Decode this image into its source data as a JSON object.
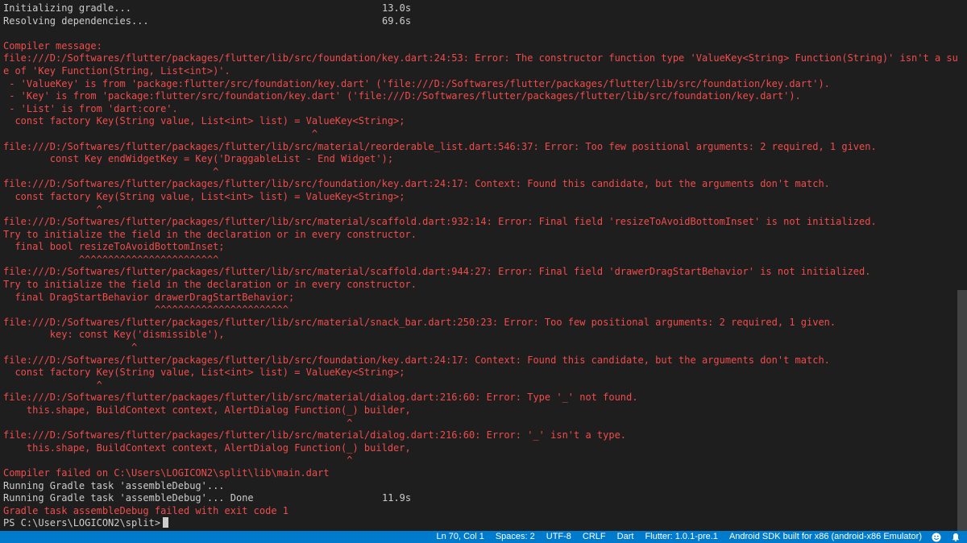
{
  "terminal": {
    "lines": [
      {
        "text": "Initializing gradle...",
        "type": "ok",
        "timing": "13.0s"
      },
      {
        "text": "Resolving dependencies...",
        "type": "ok",
        "timing": "69.6s"
      },
      {
        "text": "",
        "type": "ok"
      },
      {
        "text": "Compiler message:",
        "type": "err"
      },
      {
        "text": "file:///D:/Softwares/flutter/packages/flutter/lib/src/foundation/key.dart:24:53: Error: The constructor function type 'ValueKey<String> Function(String)' isn't a subtyp",
        "type": "err"
      },
      {
        "text": "e of 'Key Function(String, List<int>)'.",
        "type": "err"
      },
      {
        "text": " - 'ValueKey' is from 'package:flutter/src/foundation/key.dart' ('file:///D:/Softwares/flutter/packages/flutter/lib/src/foundation/key.dart').",
        "type": "err"
      },
      {
        "text": " - 'Key' is from 'package:flutter/src/foundation/key.dart' ('file:///D:/Softwares/flutter/packages/flutter/lib/src/foundation/key.dart').",
        "type": "err"
      },
      {
        "text": " - 'List' is from 'dart:core'.",
        "type": "err"
      },
      {
        "text": "  const factory Key(String value, List<int> list) = ValueKey<String>;",
        "type": "err"
      },
      {
        "text": "                                                     ^",
        "type": "err"
      },
      {
        "text": "file:///D:/Softwares/flutter/packages/flutter/lib/src/material/reorderable_list.dart:546:37: Error: Too few positional arguments: 2 required, 1 given.",
        "type": "err"
      },
      {
        "text": "        const Key endWidgetKey = Key('DraggableList - End Widget');",
        "type": "err"
      },
      {
        "text": "                                    ^",
        "type": "err"
      },
      {
        "text": "file:///D:/Softwares/flutter/packages/flutter/lib/src/foundation/key.dart:24:17: Context: Found this candidate, but the arguments don't match.",
        "type": "err"
      },
      {
        "text": "  const factory Key(String value, List<int> list) = ValueKey<String>;",
        "type": "err"
      },
      {
        "text": "                ^",
        "type": "err"
      },
      {
        "text": "file:///D:/Softwares/flutter/packages/flutter/lib/src/material/scaffold.dart:932:14: Error: Final field 'resizeToAvoidBottomInset' is not initialized.",
        "type": "err"
      },
      {
        "text": "Try to initialize the field in the declaration or in every constructor.",
        "type": "err"
      },
      {
        "text": "  final bool resizeToAvoidBottomInset;",
        "type": "err"
      },
      {
        "text": "             ^^^^^^^^^^^^^^^^^^^^^^^^",
        "type": "err"
      },
      {
        "text": "file:///D:/Softwares/flutter/packages/flutter/lib/src/material/scaffold.dart:944:27: Error: Final field 'drawerDragStartBehavior' is not initialized.",
        "type": "err"
      },
      {
        "text": "Try to initialize the field in the declaration or in every constructor.",
        "type": "err"
      },
      {
        "text": "  final DragStartBehavior drawerDragStartBehavior;",
        "type": "err"
      },
      {
        "text": "                          ^^^^^^^^^^^^^^^^^^^^^^^",
        "type": "err"
      },
      {
        "text": "file:///D:/Softwares/flutter/packages/flutter/lib/src/material/snack_bar.dart:250:23: Error: Too few positional arguments: 2 required, 1 given.",
        "type": "err"
      },
      {
        "text": "        key: const Key('dismissible'),",
        "type": "err"
      },
      {
        "text": "                      ^",
        "type": "err"
      },
      {
        "text": "file:///D:/Softwares/flutter/packages/flutter/lib/src/foundation/key.dart:24:17: Context: Found this candidate, but the arguments don't match.",
        "type": "err"
      },
      {
        "text": "  const factory Key(String value, List<int> list) = ValueKey<String>;",
        "type": "err"
      },
      {
        "text": "                ^",
        "type": "err"
      },
      {
        "text": "file:///D:/Softwares/flutter/packages/flutter/lib/src/material/dialog.dart:216:60: Error: Type '_' not found.",
        "type": "err"
      },
      {
        "text": "    this.shape, BuildContext context, AlertDialog Function(_) builder,",
        "type": "err"
      },
      {
        "text": "                                                           ^",
        "type": "err"
      },
      {
        "text": "file:///D:/Softwares/flutter/packages/flutter/lib/src/material/dialog.dart:216:60: Error: '_' isn't a type.",
        "type": "err"
      },
      {
        "text": "    this.shape, BuildContext context, AlertDialog Function(_) builder,",
        "type": "err"
      },
      {
        "text": "                                                           ^",
        "type": "err"
      },
      {
        "text": "Compiler failed on C:\\Users\\LOGICON2\\split\\lib\\main.dart",
        "type": "err"
      },
      {
        "text": "Running Gradle task 'assembleDebug'...",
        "type": "ok"
      },
      {
        "text": "Running Gradle task 'assembleDebug'... Done",
        "type": "ok",
        "timing": "11.9s"
      },
      {
        "text": "Gradle task assembleDebug failed with exit code 1",
        "type": "err"
      }
    ],
    "prompt": "PS C:\\Users\\LOGICON2\\split>"
  },
  "statusbar": {
    "items": [
      {
        "name": "status-cursor-position",
        "label": "Ln 70, Col 1"
      },
      {
        "name": "status-indentation",
        "label": "Spaces: 2"
      },
      {
        "name": "status-encoding",
        "label": "UTF-8"
      },
      {
        "name": "status-line-ending",
        "label": "CRLF"
      },
      {
        "name": "status-language",
        "label": "Dart"
      },
      {
        "name": "status-flutter-version",
        "label": "Flutter: 1.0.1-pre.1"
      },
      {
        "name": "status-device",
        "label": "Android SDK built for x86 (android-x86 Emulator)"
      }
    ],
    "icons": [
      "feedback-smiley-icon",
      "notifications-bell-icon"
    ]
  },
  "colors": {
    "background": "#1e1e1e",
    "text": "#cccccc",
    "error": "#f14c4c",
    "statusbar": "#007acc"
  }
}
